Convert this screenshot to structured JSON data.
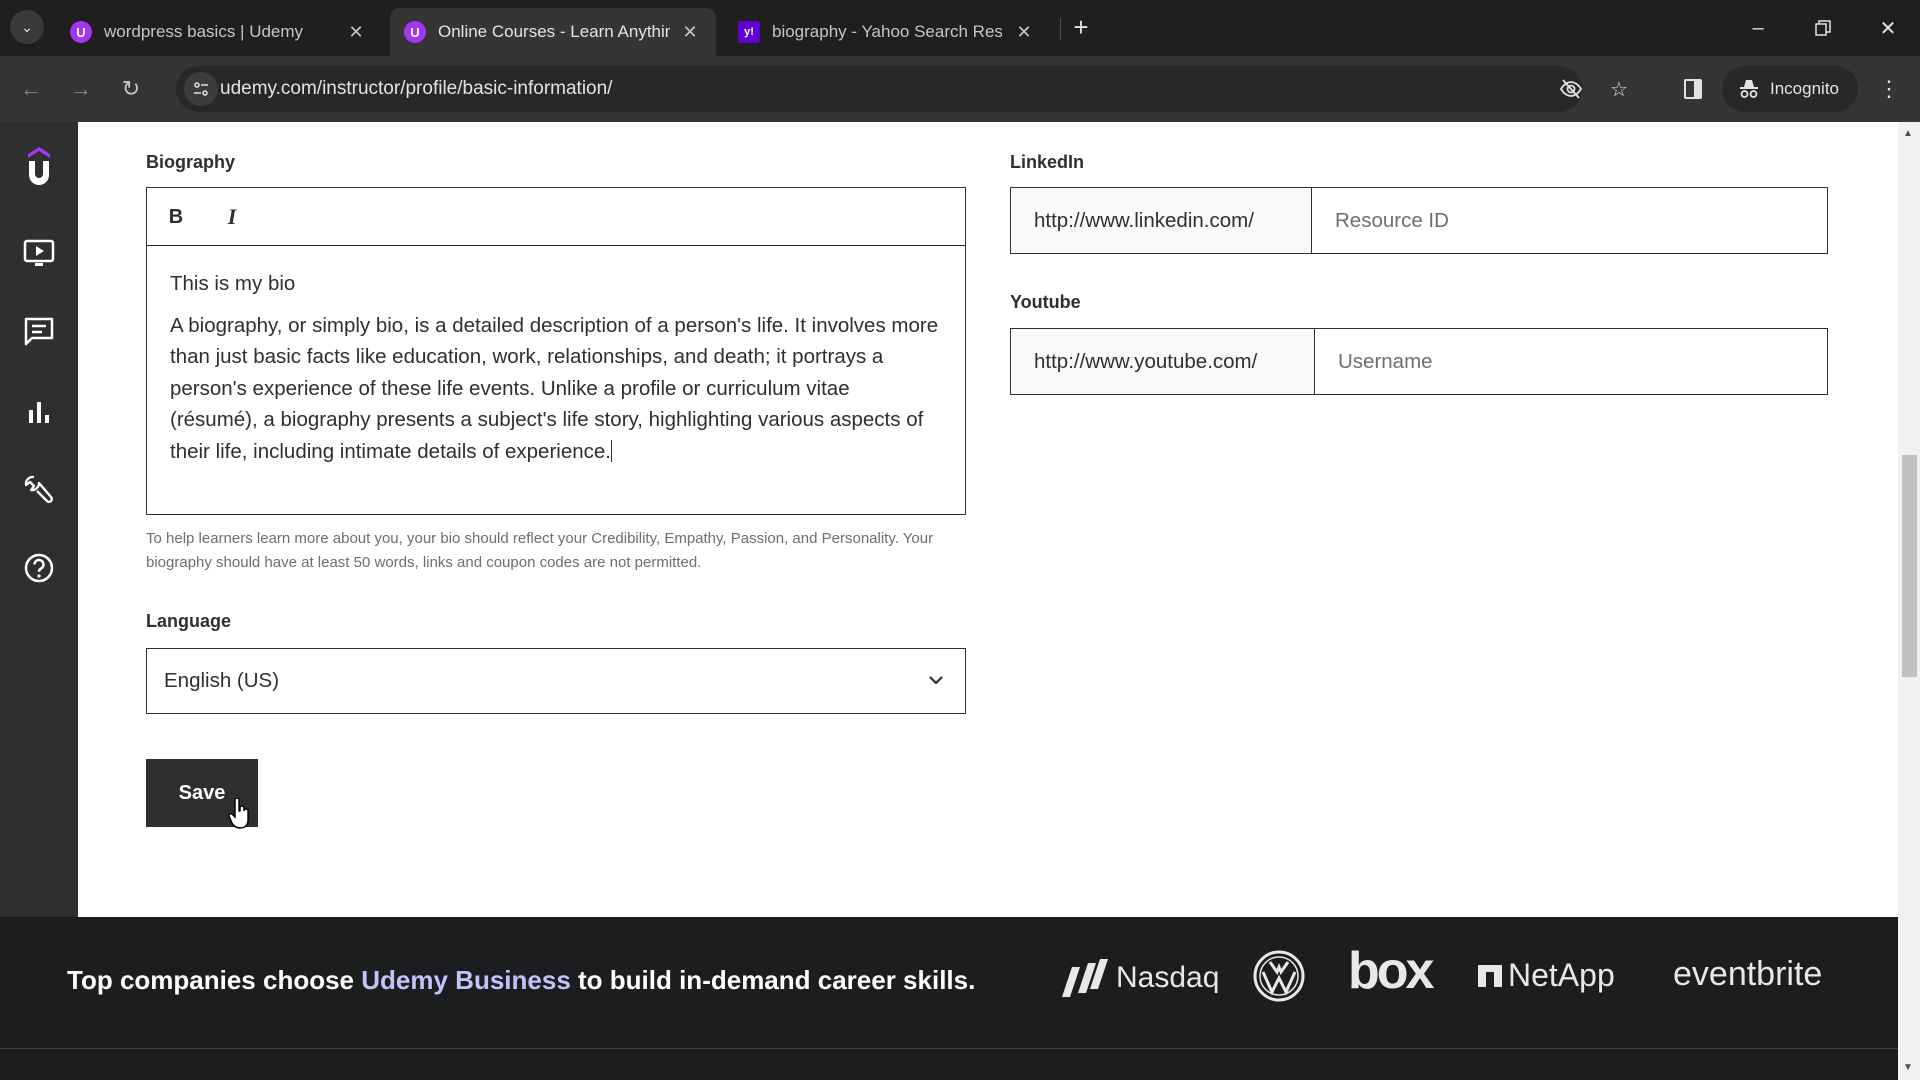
{
  "browser": {
    "tabs": [
      {
        "title": "wordpress basics | Udemy",
        "favicon": "udemy-icon",
        "active": false
      },
      {
        "title": "Online Courses - Learn Anythin",
        "favicon": "udemy-icon",
        "active": true
      },
      {
        "title": "biography - Yahoo Search Resu",
        "favicon": "yahoo-icon",
        "active": false
      }
    ],
    "url": "udemy.com/instructor/profile/basic-information/",
    "incognito_label": "Incognito",
    "favicon_glyphs": {
      "udemy": "U",
      "yahoo": "y!"
    }
  },
  "sidebar": {
    "items": [
      {
        "name": "courses",
        "icon": "play-screen-icon"
      },
      {
        "name": "communication",
        "icon": "chat-icon"
      },
      {
        "name": "performance",
        "icon": "bar-chart-icon"
      },
      {
        "name": "tools",
        "icon": "wrench-icon"
      },
      {
        "name": "resources",
        "icon": "help-icon"
      }
    ]
  },
  "form": {
    "biography": {
      "label": "Biography",
      "bold_label": "B",
      "italic_label": "I",
      "paragraphs": [
        "This is my bio",
        "A biography, or simply bio, is a detailed description of a person's life. It involves more than just basic facts like education, work, relationships, and death; it portrays a person's experience of these life events. Unlike a profile or curriculum vitae (résumé), a biography presents a subject's life story, highlighting various aspects of their life, including intimate details of experience."
      ],
      "help_text": "To help learners learn more about you, your bio should reflect your Credibility, Empathy, Passion, and Personality. Your biography should have at least 50 words, links and coupon codes are not permitted."
    },
    "language": {
      "label": "Language",
      "selected": "English (US)"
    },
    "save_label": "Save",
    "linkedin": {
      "label": "LinkedIn",
      "prefix": "http://www.linkedin.com/",
      "value": "",
      "placeholder": "Resource ID"
    },
    "youtube": {
      "label": "Youtube",
      "prefix": "http://www.youtube.com/",
      "value": "",
      "placeholder": "Username"
    }
  },
  "footer": {
    "tagline_pre": "Top companies choose ",
    "tagline_accent": "Udemy Business",
    "tagline_post": " to build in-demand career skills.",
    "logos": [
      "Nasdaq",
      "Volkswagen",
      "box",
      "NetApp",
      "eventbrite"
    ]
  },
  "colors": {
    "brand": "#a435f0",
    "ink": "#2d2f31",
    "footer_bg": "#1c1d1f",
    "accent_link": "#c0c4fc"
  }
}
